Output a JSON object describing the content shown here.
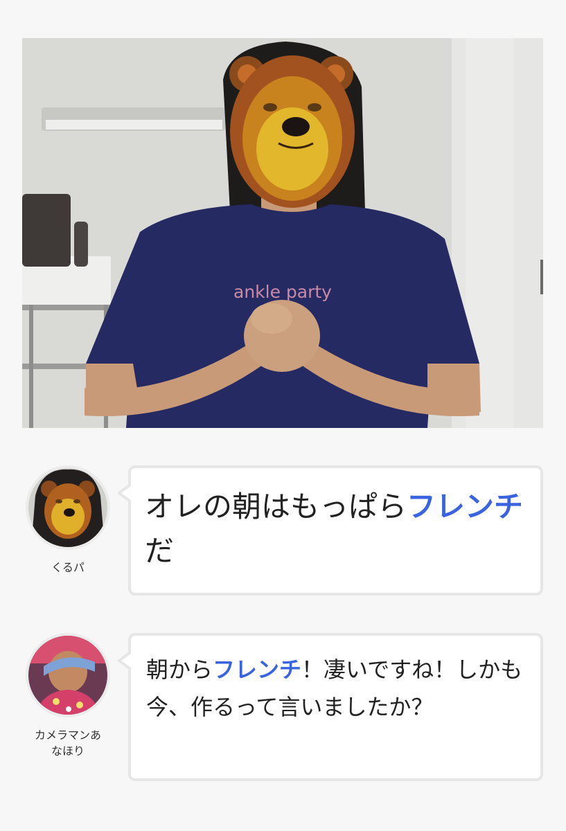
{
  "photo": {
    "shirt_text": "ankle party"
  },
  "messages": [
    {
      "speaker": "くるパ",
      "avatar": "bear-mask-avatar",
      "text_parts": [
        {
          "text": "オレの朝はもっぱら",
          "highlight": false
        },
        {
          "text": "フレンチ",
          "highlight": true
        },
        {
          "text": "だ",
          "highlight": false
        }
      ]
    },
    {
      "speaker": "カメラマンあ\nなほり",
      "avatar": "cameraman-avatar",
      "text_parts": [
        {
          "text": "朝から",
          "highlight": false
        },
        {
          "text": "フレンチ",
          "highlight": true
        },
        {
          "text": "！凄いですね！しかも今、作るって言いましたか？",
          "highlight": false
        }
      ]
    }
  ],
  "colors": {
    "highlight": "#3a63e0",
    "bubble_border": "#e6e6e6",
    "page_background": "#f7f7f7"
  }
}
